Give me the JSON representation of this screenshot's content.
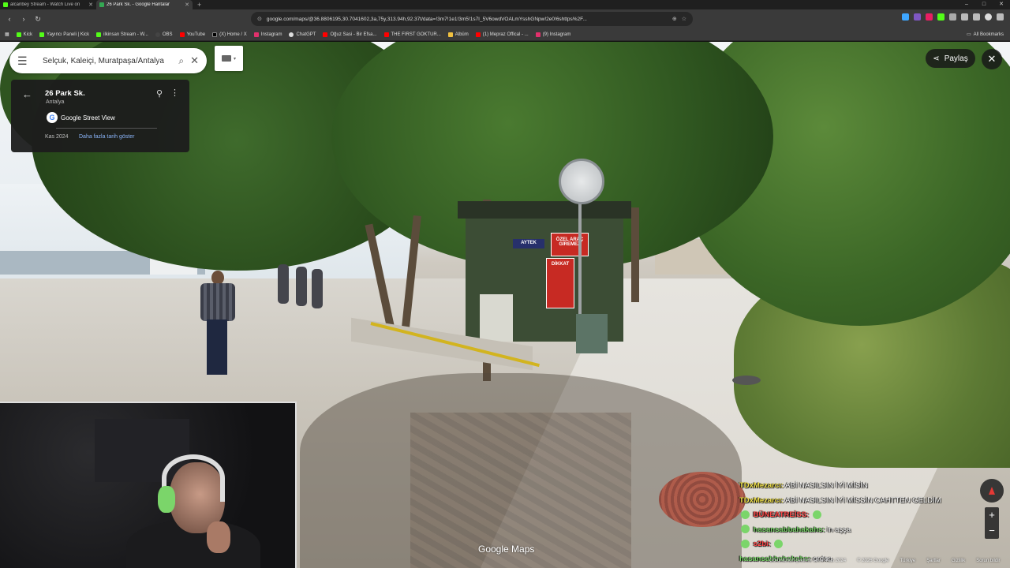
{
  "browser": {
    "tabs": [
      {
        "title": "alcanbey Stream - Watch Live on",
        "favicon_color": "#53fc18",
        "active": false
      },
      {
        "title": "26 Park Sk. - Google Haritalar",
        "favicon_color": "#34a853",
        "active": true
      }
    ],
    "new_tab": "+",
    "window_controls": [
      "–",
      "□",
      "✕"
    ],
    "url": "google.com/maps/@36.8806195,30.7041602,3a,75y,313.94h,92.37t/data=!3m7!1e1!3m5!1s7I_5V6owdVOALmYsshGNpw!2e0!6shttps%2F...",
    "bookmarks": [
      {
        "label": "Kick",
        "color": "#53fc18"
      },
      {
        "label": "Yayıncı Paneli | Kick",
        "color": "#53fc18"
      },
      {
        "label": "ilkinsan Stream - W...",
        "color": "#53fc18"
      },
      {
        "label": "OBS",
        "color": "#444444"
      },
      {
        "label": "YouTube",
        "color": "#ff0000"
      },
      {
        "label": "(X) Home / X",
        "color": "#000000"
      },
      {
        "label": "Instagram",
        "color": "#e1306c"
      },
      {
        "label": "ChatGPT",
        "color": "#dddddd"
      },
      {
        "label": "Oğuz Sasi - Bir Efsa...",
        "color": "#ff0000"
      },
      {
        "label": "THE FIRST GOKTUR...",
        "color": "#ff0000"
      },
      {
        "label": "Albüm",
        "color": "#f0c040"
      },
      {
        "label": "(1) Mepraz Offical - ...",
        "color": "#ff0000"
      },
      {
        "label": "(9) Instagram",
        "color": "#e1306c"
      }
    ],
    "all_bookmarks": "All Bookmarks"
  },
  "maps": {
    "search_value": "Selçuk, Kaleiçi, Muratpaşa/Antalya",
    "place_title": "26 Park Sk.",
    "place_subtitle": "Antalya",
    "source_label": "Google Street View",
    "capture_date": "Kas 2024",
    "more_dates_link": "Daha fazla tarih göster",
    "share_label": "Paylaş",
    "logo_text": "Google Maps",
    "footer": [
      "Görüntünün çekilme tarihi: Kas 2024",
      "© 2026 Google",
      "Türkiye",
      "Şartlar",
      "Gizlilik",
      "Sorun bildir"
    ]
  },
  "scene_signs": {
    "red_sign_1": "ÖZEL ARAÇ GİREMEZ",
    "red_sign_2": "DİKKAT",
    "kiosk_banner": "AYTEK"
  },
  "chat": {
    "messages": [
      {
        "user": "TDxMezarcı:",
        "text": "ABİ NASILSIN İYİ MİSİN",
        "color": "#f2e34a",
        "emote": false
      },
      {
        "user": "TDxMezarcı:",
        "text": "ABİ NASILSIN İYİ MİSSİN CAHTTEN GELDİM",
        "color": "#f2e34a",
        "emote": false
      },
      {
        "user": "BÜNEATREİSS:",
        "text": "",
        "color": "#ff4a4a",
        "emote": true
      },
      {
        "user": "hasansabbahakahs:",
        "text": "in aşşa",
        "color": "#7bd56a",
        "emote": false
      },
      {
        "user": "s2bi:",
        "text": "",
        "color": "#ff4a4a",
        "emote": true
      },
      {
        "user": "hasansabbahakahs:",
        "text": "ordan",
        "color": "#7bd56a",
        "emote": false
      }
    ]
  }
}
